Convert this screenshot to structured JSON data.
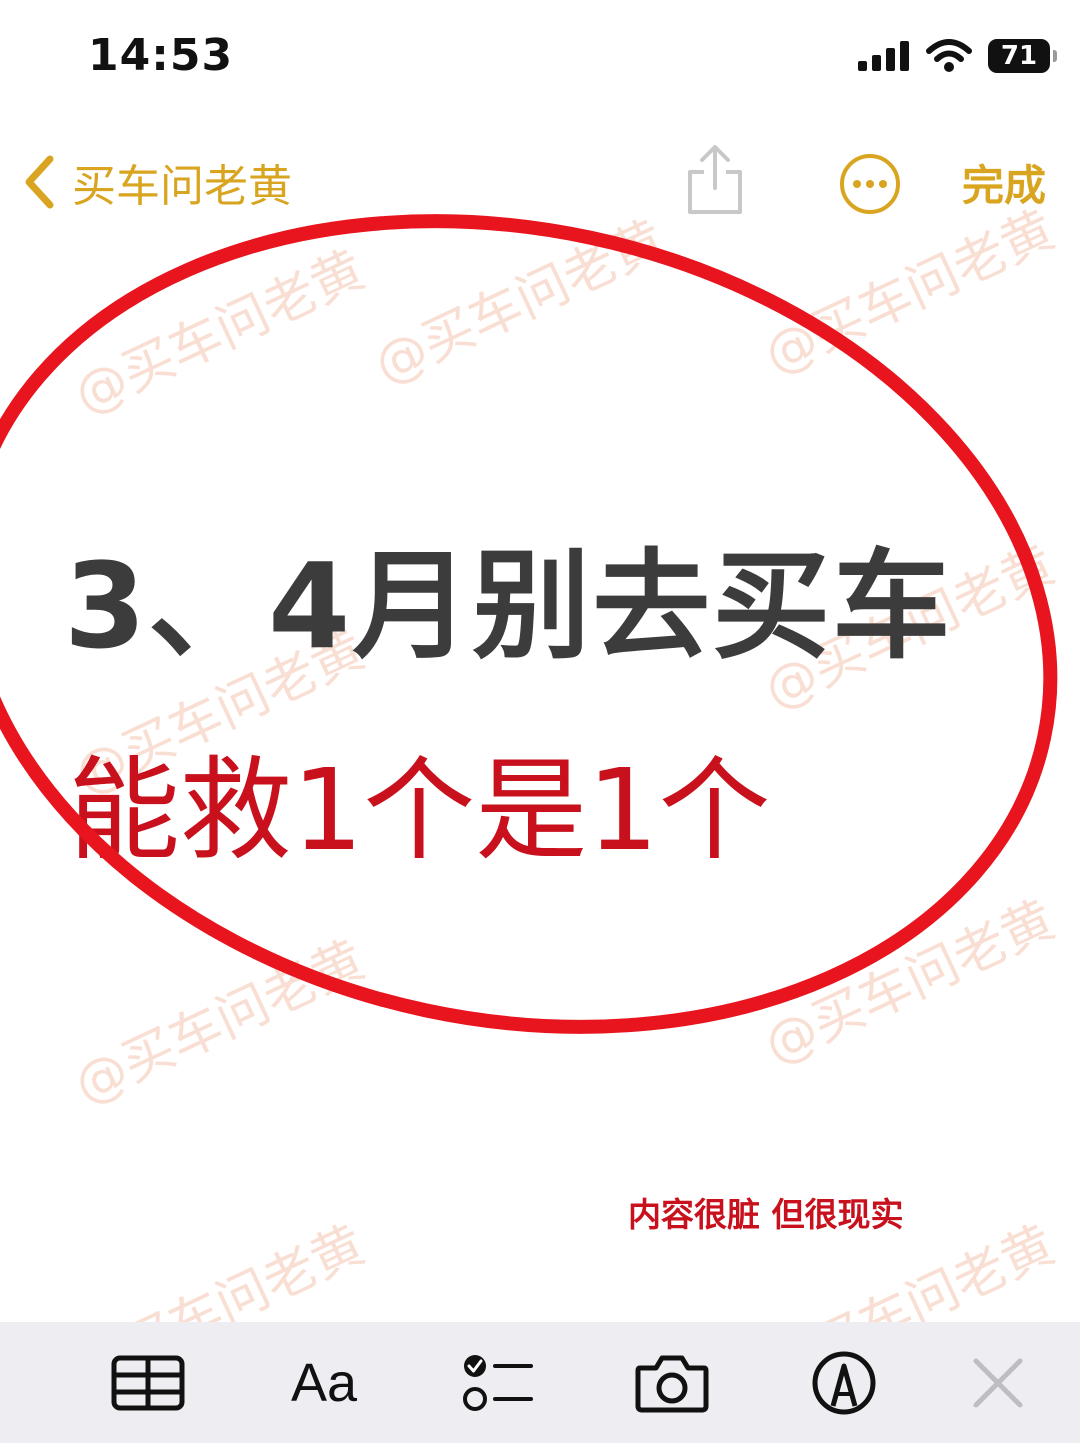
{
  "status_bar": {
    "time": "14:53",
    "battery": "71"
  },
  "nav": {
    "back_label": "买车问老黄",
    "done_label": "完成"
  },
  "note": {
    "headline": "3、4月别去买车",
    "subline": "能救1个是1个",
    "caption": "内容很脏 但很现实"
  },
  "watermark": {
    "text": "@买车问老黄"
  },
  "toolbar": {
    "format_label": "Aa",
    "items": [
      "table-icon",
      "format-text-icon",
      "checklist-icon",
      "camera-icon",
      "markup-pen-icon",
      "close-icon"
    ]
  },
  "colors": {
    "accent": "#d9a520",
    "highlight_red": "#e8141e",
    "text_red": "#c8111d",
    "headline_gray": "#3c3c3c"
  }
}
